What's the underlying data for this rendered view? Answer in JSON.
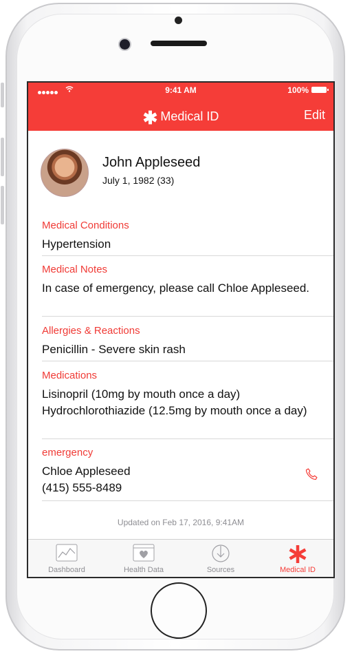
{
  "status_bar": {
    "time": "9:41 AM",
    "battery": "100%"
  },
  "nav": {
    "title": "Medical ID",
    "edit_label": "Edit"
  },
  "profile": {
    "name": "John Appleseed",
    "dob": "July 1, 1982 (33)"
  },
  "sections": [
    {
      "label": "Medical Conditions",
      "value": "Hypertension"
    },
    {
      "label": "Medical Notes",
      "value": "In case of emergency, please call Chloe Appleseed."
    },
    {
      "label": "Allergies & Reactions",
      "value": "Penicillin - Severe skin rash"
    },
    {
      "label": "Medications",
      "value_lines": [
        "Lisinopril (10mg by mouth once a day)",
        "Hydrochlorothiazide (12.5mg by mouth once a day)"
      ]
    },
    {
      "label": "emergency",
      "contact_name": "Chloe Appleseed",
      "contact_phone": "(415) 555-8489"
    }
  ],
  "updated": "Updated on Feb 17, 2016, 9:41AM",
  "tabs": [
    {
      "label": "Dashboard",
      "icon": "dashboard-icon"
    },
    {
      "label": "Health Data",
      "icon": "health-data-icon"
    },
    {
      "label": "Sources",
      "icon": "sources-icon"
    },
    {
      "label": "Medical ID",
      "icon": "medical-id-icon",
      "active": true
    }
  ],
  "colors": {
    "accent": "#f53d38",
    "inactive": "#8e8e93"
  }
}
